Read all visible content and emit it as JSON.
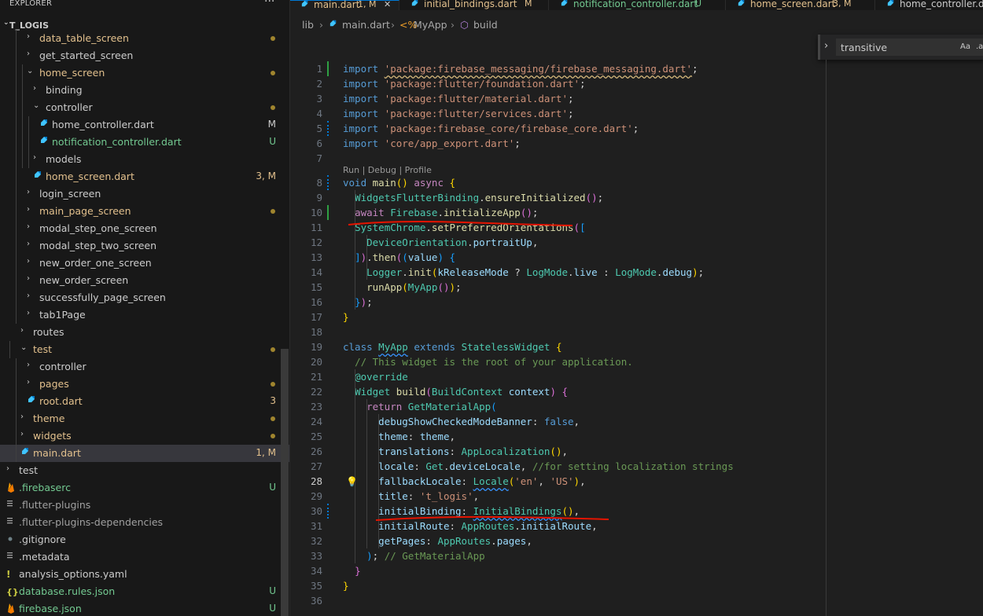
{
  "explorer": {
    "title": "EXPLORER",
    "more": "···",
    "project": "T_LOGIS"
  },
  "tree": [
    {
      "label": "data_table_screen",
      "chev": "›",
      "color": "#e2c08d",
      "dot": true,
      "badge": ""
    },
    {
      "label": "get_started_screen",
      "chev": "›",
      "color": "#cccccc",
      "dot": false,
      "badge": ""
    },
    {
      "label": "home_screen",
      "chev": "⌄",
      "color": "#e2c08d",
      "dot": true,
      "badge": ""
    },
    {
      "label": "binding",
      "chev": "›",
      "color": "#cccccc",
      "dot": false,
      "badge": ""
    },
    {
      "label": "controller",
      "chev": "⌄",
      "color": "#cccccc",
      "dot": true,
      "badge": ""
    },
    {
      "label": "home_controller.dart",
      "chev": "",
      "color": "#cccccc",
      "dot": false,
      "badge": "M"
    },
    {
      "label": "notification_controller.dart",
      "chev": "",
      "color": "#73c991",
      "dot": false,
      "badge": "U"
    },
    {
      "label": "models",
      "chev": "›",
      "color": "#cccccc",
      "dot": false,
      "badge": ""
    },
    {
      "label": "home_screen.dart",
      "chev": "",
      "color": "#e2c08d",
      "dot": false,
      "badge": "3, M"
    },
    {
      "label": "login_screen",
      "chev": "›",
      "color": "#cccccc",
      "dot": false,
      "badge": ""
    },
    {
      "label": "main_page_screen",
      "chev": "›",
      "color": "#e2c08d",
      "dot": true,
      "badge": ""
    },
    {
      "label": "modal_step_one_screen",
      "chev": "›",
      "color": "#cccccc",
      "dot": false,
      "badge": ""
    },
    {
      "label": "modal_step_two_screen",
      "chev": "›",
      "color": "#cccccc",
      "dot": false,
      "badge": ""
    },
    {
      "label": "new_order_one_screen",
      "chev": "›",
      "color": "#cccccc",
      "dot": false,
      "badge": ""
    },
    {
      "label": "new_order_screen",
      "chev": "›",
      "color": "#cccccc",
      "dot": false,
      "badge": ""
    },
    {
      "label": "successfully_page_screen",
      "chev": "›",
      "color": "#cccccc",
      "dot": false,
      "badge": ""
    },
    {
      "label": "tab1Page",
      "chev": "›",
      "color": "#cccccc",
      "dot": false,
      "badge": ""
    },
    {
      "label": "routes",
      "chev": "›",
      "color": "#cccccc",
      "dot": false,
      "badge": ""
    },
    {
      "label": "test",
      "chev": "⌄",
      "color": "#e2c08d",
      "dot": true,
      "badge": ""
    },
    {
      "label": "controller",
      "chev": "›",
      "color": "#cccccc",
      "dot": false,
      "badge": ""
    },
    {
      "label": "pages",
      "chev": "›",
      "color": "#e2c08d",
      "dot": true,
      "badge": ""
    },
    {
      "label": "root.dart",
      "chev": "",
      "color": "#e2c08d",
      "dot": false,
      "badge": "3"
    },
    {
      "label": "theme",
      "chev": "›",
      "color": "#e2c08d",
      "dot": true,
      "badge": ""
    },
    {
      "label": "widgets",
      "chev": "›",
      "color": "#e2c08d",
      "dot": true,
      "badge": ""
    },
    {
      "label": "main.dart",
      "chev": "",
      "color": "#e2c08d",
      "dot": false,
      "badge": "1, M"
    },
    {
      "label": "test",
      "chev": "›",
      "color": "#cccccc",
      "dot": false,
      "badge": ""
    },
    {
      "label": ".firebaserc",
      "chev": "",
      "color": "#73c991",
      "dot": false,
      "badge": "U"
    },
    {
      "label": ".flutter-plugins",
      "chev": "",
      "color": "#a0a0a0",
      "dot": false,
      "badge": ""
    },
    {
      "label": ".flutter-plugins-dependencies",
      "chev": "",
      "color": "#a0a0a0",
      "dot": false,
      "badge": ""
    },
    {
      "label": ".gitignore",
      "chev": "",
      "color": "#cccccc",
      "dot": false,
      "badge": ""
    },
    {
      "label": ".metadata",
      "chev": "",
      "color": "#cccccc",
      "dot": false,
      "badge": ""
    },
    {
      "label": "analysis_options.yaml",
      "chev": "",
      "color": "#cccccc",
      "dot": false,
      "badge": ""
    },
    {
      "label": "database.rules.json",
      "chev": "",
      "color": "#73c991",
      "dot": false,
      "badge": "U"
    },
    {
      "label": "firebase.json",
      "chev": "",
      "color": "#73c991",
      "dot": false,
      "badge": "U"
    }
  ],
  "tabs": [
    {
      "label": "main.dart",
      "status": "1, M",
      "active": true,
      "close": "✕",
      "color": "#e2c08d"
    },
    {
      "label": "initial_bindings.dart",
      "status": "M",
      "active": false,
      "close": "",
      "color": "#e2c08d"
    },
    {
      "label": "notification_controller.dart",
      "status": "U",
      "active": false,
      "close": "",
      "color": "#73c991"
    },
    {
      "label": "home_screen.dart",
      "status": "3, M",
      "active": false,
      "close": "",
      "color": "#e2c08d"
    },
    {
      "label": "home_controller.dart",
      "status": "",
      "active": false,
      "close": "",
      "color": "#cccccc"
    }
  ],
  "breadcrumb": {
    "part1": "lib",
    "part2": "main.dart",
    "part3": "MyApp",
    "part4": "build"
  },
  "find": {
    "value": "transitive",
    "aa": "Aa",
    "ab": ".ab"
  },
  "codelens": "Run | Debug | Profile",
  "current_line": 28,
  "colors": {
    "accent": "#0078d4",
    "modified": "#e2c08d",
    "untracked": "#73c991",
    "annotation": "#e51400"
  }
}
